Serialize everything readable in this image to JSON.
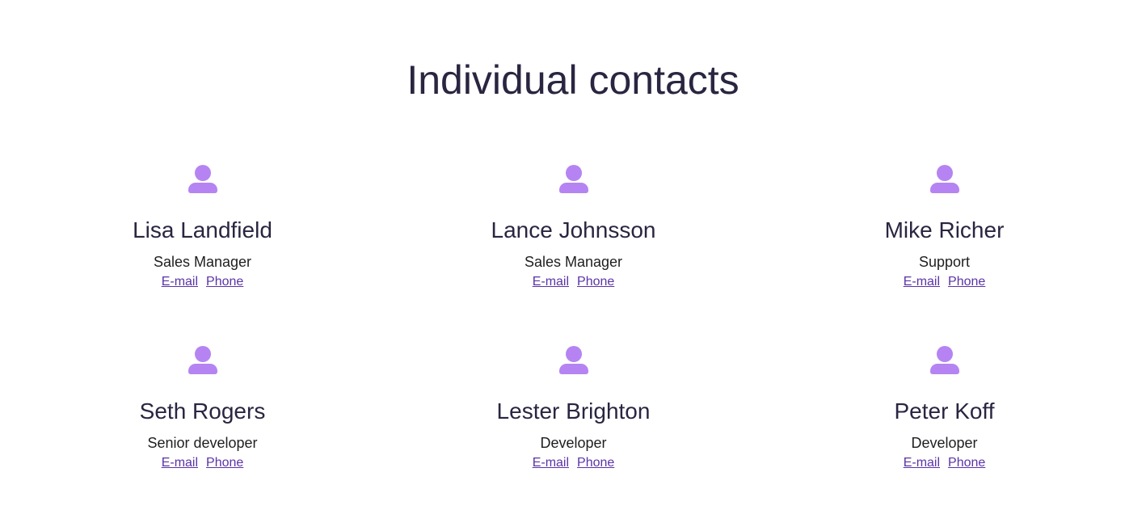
{
  "page": {
    "title": "Individual contacts"
  },
  "theme": {
    "avatar_color": "#b584f2",
    "link_color": "#5b33a6",
    "text_color": "#2a2540"
  },
  "contacts": [
    {
      "name": "Lisa Landfield",
      "role": "Sales Manager",
      "email_label": "E-mail",
      "phone_label": "Phone",
      "icon": "user-icon"
    },
    {
      "name": "Lance Johnsson",
      "role": "Sales Manager",
      "email_label": "E-mail",
      "phone_label": "Phone",
      "icon": "user-icon"
    },
    {
      "name": "Mike Richer",
      "role": "Support",
      "email_label": "E-mail",
      "phone_label": "Phone",
      "icon": "user-icon"
    },
    {
      "name": "Seth Rogers",
      "role": "Senior developer",
      "email_label": "E-mail",
      "phone_label": "Phone",
      "icon": "user-icon"
    },
    {
      "name": "Lester Brighton",
      "role": "Developer",
      "email_label": "E-mail",
      "phone_label": "Phone",
      "icon": "user-icon"
    },
    {
      "name": "Peter Koff",
      "role": "Developer",
      "email_label": "E-mail",
      "phone_label": "Phone",
      "icon": "user-icon"
    }
  ]
}
